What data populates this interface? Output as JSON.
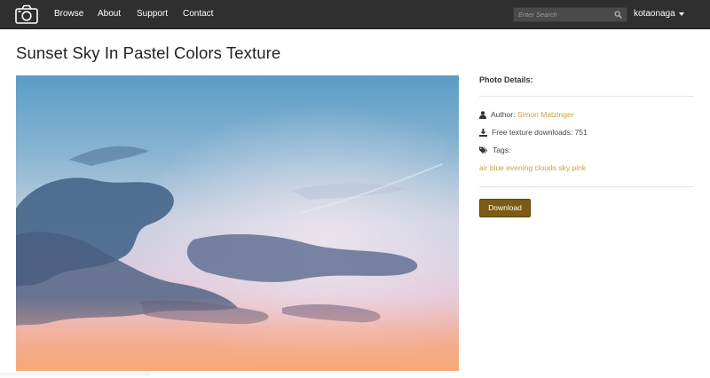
{
  "nav": {
    "logo_icon": "camera-icon",
    "links": [
      "Browse",
      "About",
      "Support",
      "Contact"
    ],
    "search_placeholder": "Enter Search",
    "search_icon": "search-icon",
    "username": "kotaonaga"
  },
  "page": {
    "title": "Sunset Sky In Pastel Colors Texture"
  },
  "details": {
    "heading": "Photo Details:",
    "author_label": "Author:",
    "author_name": "Simon Matzinger",
    "downloads_label": "Free texture downloads:",
    "downloads_count": "751",
    "tags_label": "Tags:",
    "tags": [
      "air",
      "blue",
      "evening",
      "clouds",
      "sky",
      "pink"
    ]
  },
  "actions": {
    "download_label": "Download"
  },
  "colors": {
    "navbar_bg": "#2f2f2f",
    "accent_link": "#c9a23a",
    "download_bg": "#7a5c14"
  }
}
